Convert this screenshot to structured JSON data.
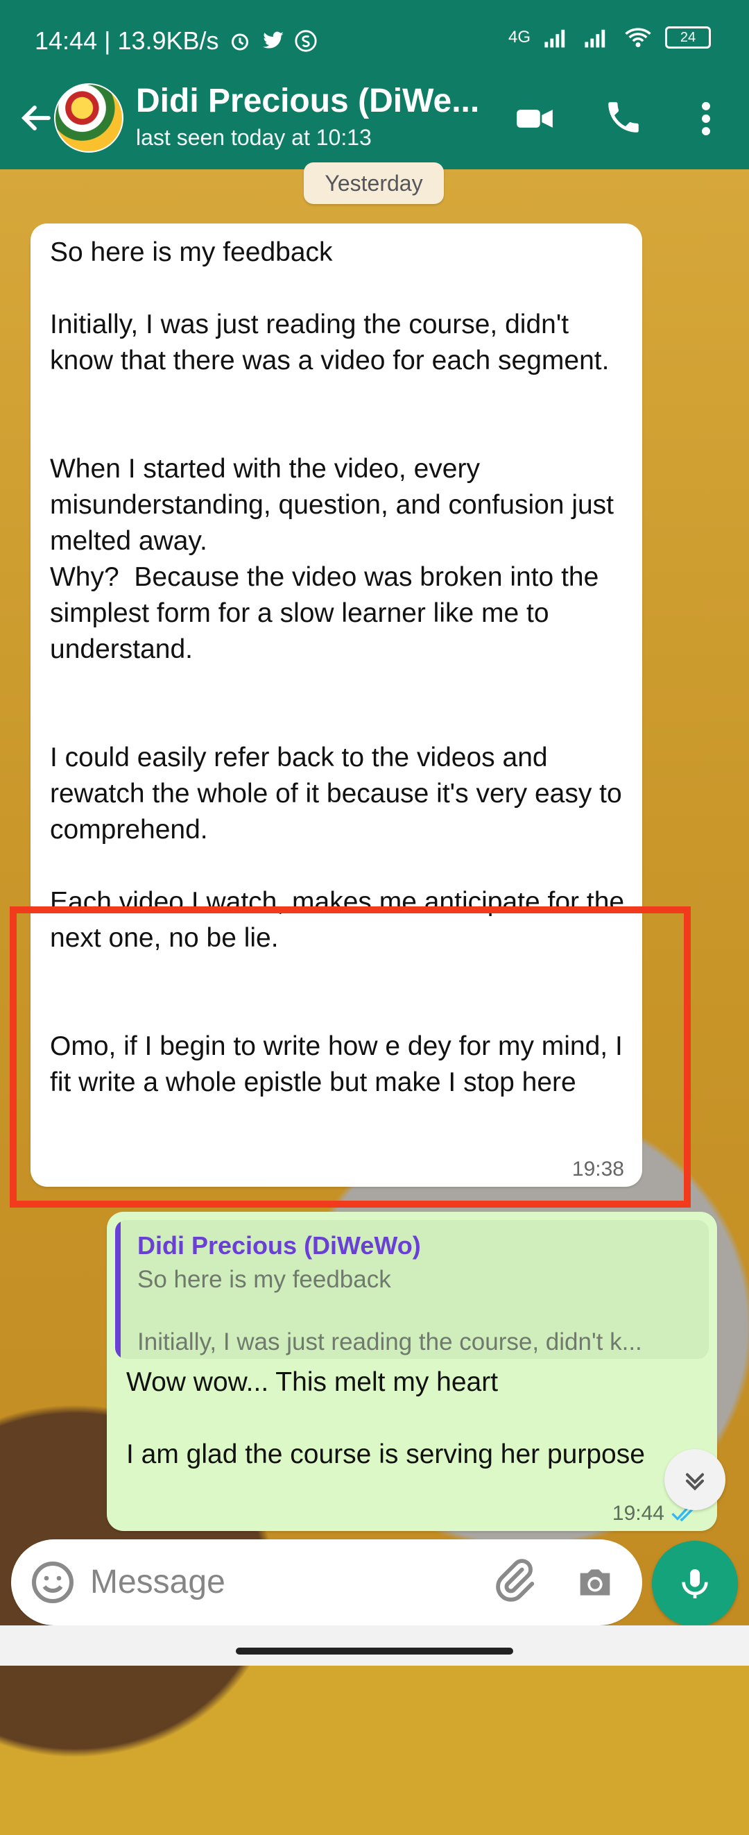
{
  "statusbar": {
    "time_speed": "14:44 | 13.9KB/s",
    "network": "4G",
    "battery": "24"
  },
  "chat": {
    "title": "Didi Precious (DiWe...",
    "subtitle": "last seen today at 10:13",
    "date_chip": "Yesterday"
  },
  "messages": {
    "incoming": {
      "text": "So here is my feedback\n\nInitially, I was just reading the course, didn't know that there was a video for each segment.\n\n\nWhen I started with the video, every misunderstanding, question, and confusion just melted away.\nWhy?  Because the video was broken into the simplest form for a slow learner like me to understand.\n\n\nI could easily refer back to the videos and rewatch the whole of it because it's very easy to comprehend.\n\nEach video I watch, makes me anticipate for the next one, no be lie.\n\n\nOmo, if I begin to write how e dey for my mind, I fit write a whole epistle but make I stop here",
      "time": "19:38"
    },
    "outgoing": {
      "quote_author": "Didi Precious (DiWeWo)",
      "quote_line1": "So here is my feedback",
      "quote_line2": "Initially, I was just reading the course, didn't k...",
      "text": "Wow wow... This melt my heart\n\nI am glad the course is serving her purpose",
      "time": "19:44"
    }
  },
  "composer": {
    "placeholder": "Message"
  },
  "colors": {
    "header": "#0f7d66",
    "incoming_bubble": "#ffffff",
    "outgoing_bubble": "#dcf8c6",
    "highlight": "#f23b1d",
    "mic_button": "#14a37a"
  },
  "icons": [
    "back-icon",
    "video-call-icon",
    "phone-icon",
    "more-icon",
    "alarm-icon",
    "twitter-icon",
    "s-icon",
    "signal-icon",
    "wifi-icon",
    "emoji-icon",
    "attach-icon",
    "camera-icon",
    "mic-icon",
    "chevron-down-icon",
    "double-check-icon"
  ]
}
